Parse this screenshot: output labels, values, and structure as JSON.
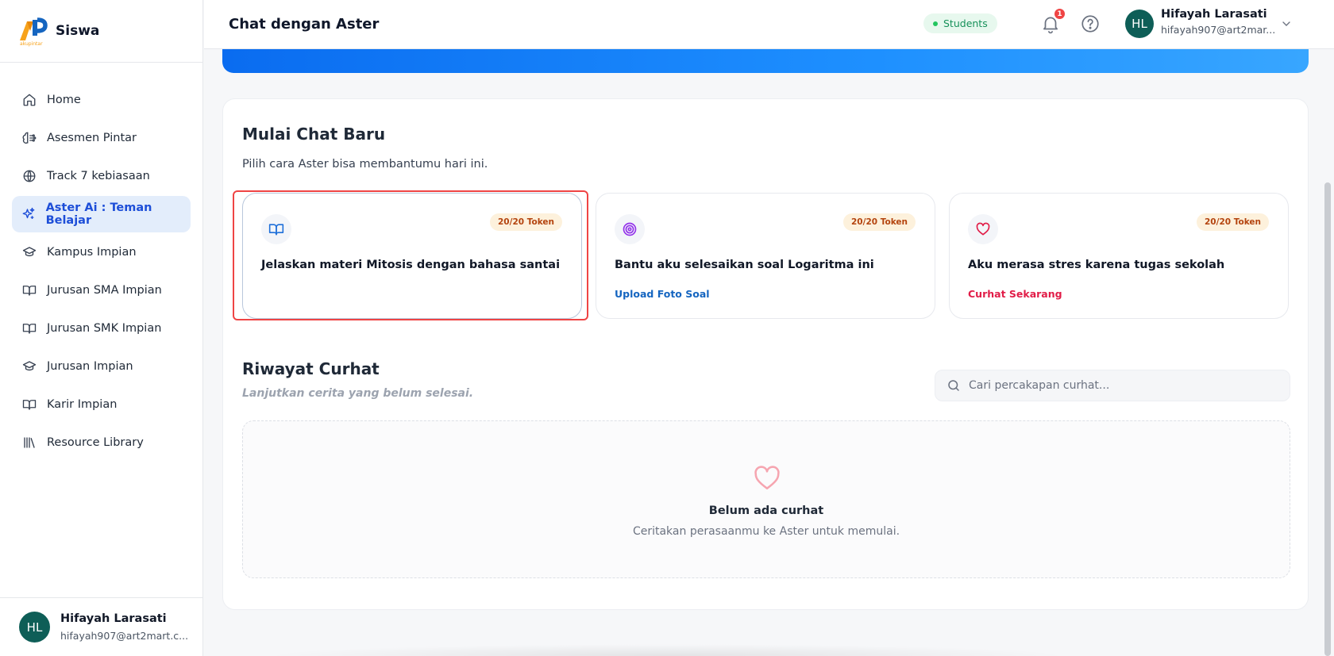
{
  "brand": {
    "name": "Siswa",
    "logo_caption": "akupintar"
  },
  "sidebar": {
    "items": [
      {
        "label": "Home",
        "icon": "home-icon",
        "active": false
      },
      {
        "label": "Asesmen Pintar",
        "icon": "brain-icon",
        "active": false
      },
      {
        "label": "Track 7 kebiasaan",
        "icon": "globe-icon",
        "active": false
      },
      {
        "label": "Aster Ai : Teman Belajar",
        "icon": "sparkles-icon",
        "active": true
      },
      {
        "label": "Kampus Impian",
        "icon": "graduation-cap-icon",
        "active": false
      },
      {
        "label": "Jurusan SMA Impian",
        "icon": "book-open-icon",
        "active": false
      },
      {
        "label": "Jurusan SMK Impian",
        "icon": "book-open-icon",
        "active": false
      },
      {
        "label": "Jurusan Impian",
        "icon": "graduation-cap-icon",
        "active": false
      },
      {
        "label": "Karir Impian",
        "icon": "book-open-icon",
        "active": false
      },
      {
        "label": "Resource Library",
        "icon": "library-icon",
        "active": false
      }
    ],
    "user": {
      "initials": "HL",
      "name": "Hifayah Larasati",
      "email": "hifayah907@art2mart.c..."
    }
  },
  "header": {
    "title": "Chat dengan Aster",
    "role_badge": "Students",
    "notification_count": "1",
    "user": {
      "initials": "HL",
      "name": "Hifayah Larasati",
      "email": "hifayah907@art2mar..."
    }
  },
  "new_chat": {
    "title": "Mulai Chat Baru",
    "subtitle": "Pilih cara Aster bisa membantumu hari ini.",
    "options": [
      {
        "icon": "book-open-icon",
        "token": "20/20 Token",
        "title": "Jelaskan materi Mitosis dengan bahasa santai",
        "link": ""
      },
      {
        "icon": "target-icon",
        "token": "20/20 Token",
        "title": "Bantu aku selesaikan soal Logaritma ini",
        "link": "Upload Foto Soal"
      },
      {
        "icon": "heart-icon",
        "token": "20/20 Token",
        "title": "Aku merasa stres karena tugas sekolah",
        "link": "Curhat Sekarang"
      }
    ]
  },
  "history": {
    "title": "Riwayat Curhat",
    "subtitle": "Lanjutkan cerita yang belum selesai.",
    "search_placeholder": "Cari percakapan curhat...",
    "empty_title": "Belum ada curhat",
    "empty_subtitle": "Ceritakan perasaanmu ke Aster untuk memulai."
  },
  "colors": {
    "accent": "#1d4ed8",
    "active_bg": "#e3edfb",
    "hero_gradient": [
      "#0a6cf0",
      "#38a6ff"
    ],
    "token_text": "#b4440e",
    "link_blue": "#1565c0",
    "link_red": "#e11d48",
    "highlight": "#ef4444"
  }
}
